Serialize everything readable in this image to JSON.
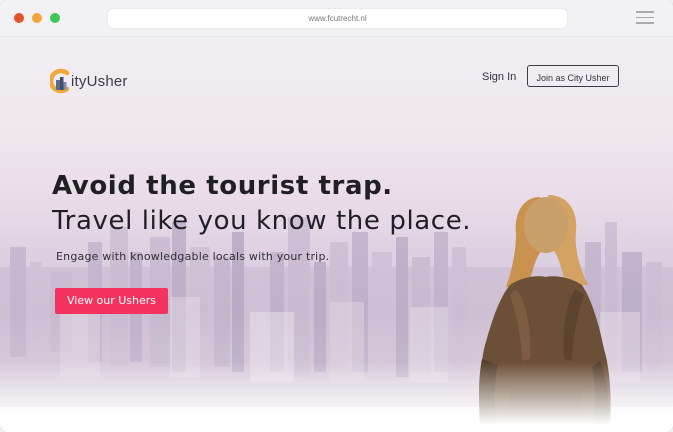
{
  "browser": {
    "url": "www.fcutrecht.nl",
    "traffic_lights": [
      "#e2552b",
      "#f2a53a",
      "#3fc65a"
    ],
    "menu_icon": "hamburger-icon"
  },
  "header": {
    "logo_text": "ityUsher",
    "logo_icon": "city-c-logo-icon",
    "signin_label": "Sign In",
    "join_label": "Join as City Usher"
  },
  "hero": {
    "headline_bold": "Avoid the tourist trap.",
    "headline_regular": "Travel like you know the place.",
    "subtitle": "Engage with knowledgable locals with your trip.",
    "cta_label": "View our Ushers",
    "cta_color": "#f2345e"
  }
}
